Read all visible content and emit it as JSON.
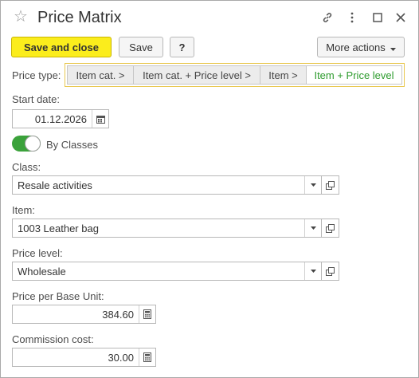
{
  "window": {
    "title": "Price Matrix"
  },
  "toolbar": {
    "save_and_close_label": "Save and close",
    "save_label": "Save",
    "help_label": "?",
    "more_actions_label": "More actions"
  },
  "price_type": {
    "label": "Price type:",
    "options": [
      "Item cat. >",
      "Item cat. + Price level >",
      "Item >",
      "Item + Price level"
    ],
    "selected": "Item + Price level"
  },
  "start_date": {
    "label": "Start date:",
    "value": "01.12.2026"
  },
  "by_classes": {
    "label": "By Classes",
    "on": true
  },
  "class_field": {
    "label": "Class:",
    "value": "Resale activities"
  },
  "item_field": {
    "label": "Item:",
    "value": "1003 Leather bag"
  },
  "price_level": {
    "label": "Price level:",
    "value": "Wholesale"
  },
  "price_per_base_unit": {
    "label": "Price per Base Unit:",
    "value": "384.60"
  },
  "commission_cost": {
    "label": "Commission cost:",
    "value": "30.00"
  },
  "colors": {
    "primary": "#fbed1c",
    "accent_green": "#3ba23b",
    "selected_text": "#2d9b2d",
    "group_border": "#e8c74e"
  },
  "icons": [
    "star-icon",
    "link-icon",
    "more-vert-icon",
    "maximize-icon",
    "close-icon",
    "calendar-icon",
    "dropdown-icon",
    "open-icon",
    "calculator-icon"
  ]
}
